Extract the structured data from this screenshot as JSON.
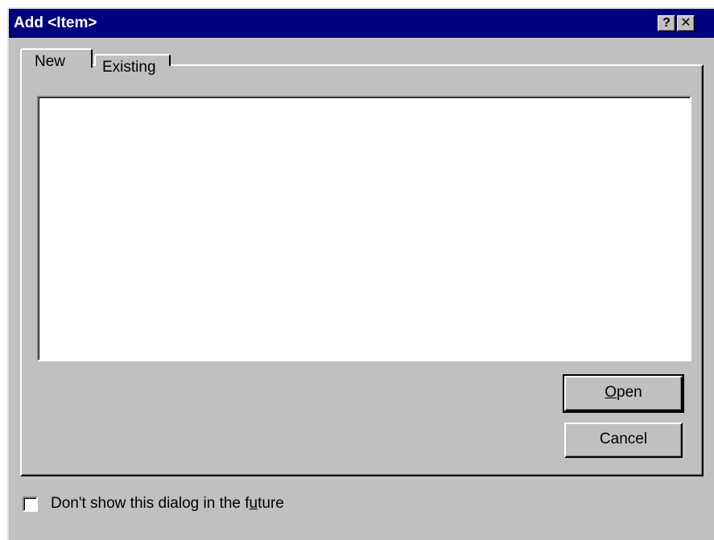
{
  "window": {
    "title": "Add <Item>",
    "help_button": "?",
    "close_button": "✕"
  },
  "tabs": [
    {
      "label": "New",
      "selected": true
    },
    {
      "label": "Existing",
      "selected": false
    }
  ],
  "listbox": {
    "items": []
  },
  "buttons": {
    "open_label": "Open",
    "cancel_label": "Cancel"
  },
  "checkbox": {
    "label": "Don't show this dialog in the future",
    "checked": false
  },
  "colors": {
    "titlebar": "#000080",
    "face": "#c0c0c0",
    "window_bg": "#ffffff"
  }
}
